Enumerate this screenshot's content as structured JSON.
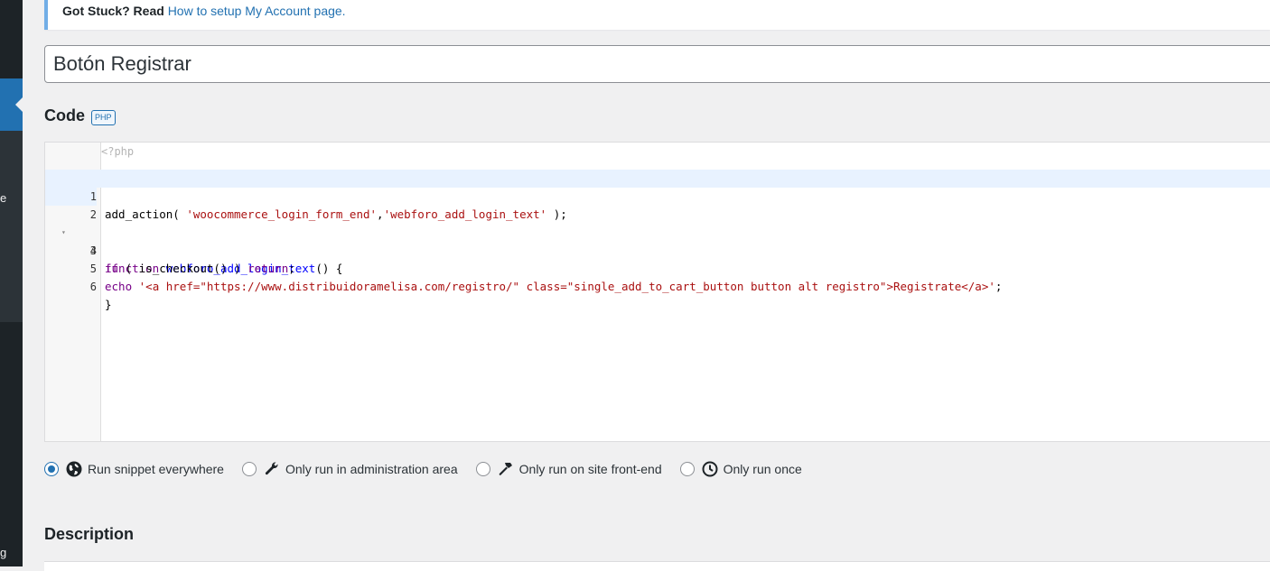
{
  "notice": {
    "prefix": "Got Stuck? Read",
    "link_text": "How to setup My Account page."
  },
  "sidebar": {
    "letter_1": "e",
    "letter_2": "g"
  },
  "snippet": {
    "title": "Botón Registrar"
  },
  "code_section": {
    "heading": "Code",
    "badge": "PHP",
    "php_open": "<?php",
    "lines": [
      {
        "num": "1",
        "text": "add_action( 'woocommerce_login_form_end','webforo_add_login_text' );"
      },
      {
        "num": "2",
        "text": ""
      },
      {
        "num": "3",
        "text": "function webforo_add_login_text() {"
      },
      {
        "num": "4",
        "text": "if ( is_checkout() ) return;"
      },
      {
        "num": "5",
        "text": "echo '<a href=\"https://www.distribuidoramelisa.com/registro/\" class=\"single_add_to_cart_button button alt registro\">Registrate</a>';"
      },
      {
        "num": "6",
        "text": "}"
      }
    ],
    "fold_marker": "▾"
  },
  "scopes": [
    {
      "label": "Run snippet everywhere",
      "icon": "globe-icon",
      "checked": true
    },
    {
      "label": "Only run in administration area",
      "icon": "wrench-icon",
      "checked": false
    },
    {
      "label": "Only run on site front-end",
      "icon": "hammer-icon",
      "checked": false
    },
    {
      "label": "Only run once",
      "icon": "clock-icon",
      "checked": false
    }
  ],
  "description": {
    "heading": "Description"
  },
  "colors": {
    "accent": "#2271b1",
    "sidebar": "#1d2327"
  }
}
